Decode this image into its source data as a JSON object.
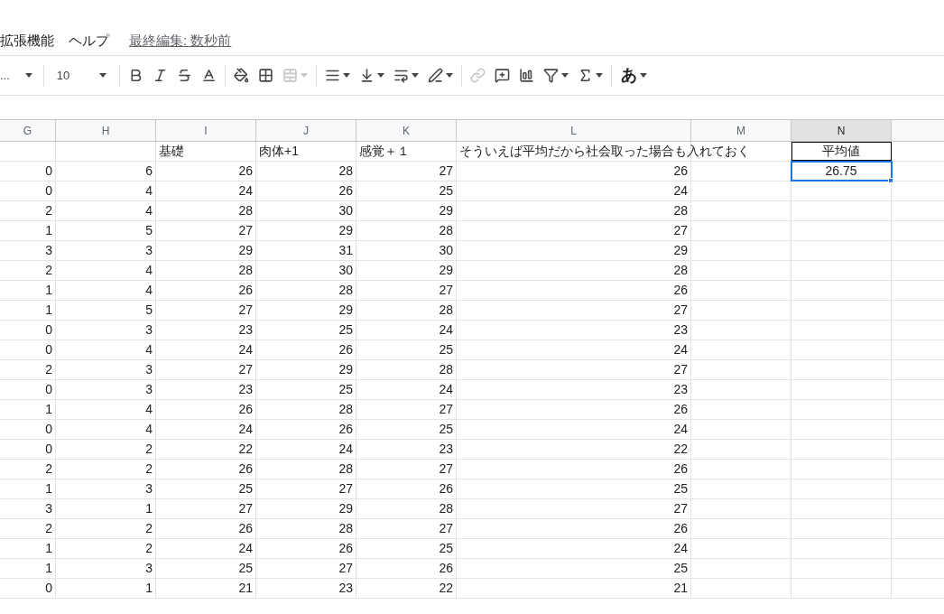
{
  "menu": {
    "items": [
      "拡張機能",
      "ヘルプ"
    ],
    "last_edit": "最終編集: 数秒前"
  },
  "toolbar": {
    "font": "...",
    "font_size": "10",
    "merge_disabled": true,
    "link_disabled": true,
    "input_tool": "あ"
  },
  "columns": [
    {
      "label": "G",
      "selected": false,
      "centered": false
    },
    {
      "label": "H",
      "selected": false,
      "centered": false
    },
    {
      "label": "I",
      "selected": false,
      "centered": false
    },
    {
      "label": "J",
      "selected": false,
      "centered": false
    },
    {
      "label": "K",
      "selected": false,
      "centered": false
    },
    {
      "label": "L",
      "selected": false,
      "centered": false
    },
    {
      "label": "M",
      "selected": false,
      "centered": false
    },
    {
      "label": "N",
      "selected": true,
      "centered": true
    }
  ],
  "rows": [
    {
      "kind": "label",
      "bordered": true,
      "values": {
        "I": "基礎",
        "J": "肉体+1",
        "K": "感覚＋１",
        "L": "そういえば平均だから社会取った場合も入れておく",
        "N": "平均値"
      }
    },
    {
      "kind": "number",
      "values": {
        "G": "0",
        "H": "6",
        "I": "26",
        "J": "28",
        "K": "27",
        "L": "26"
      },
      "active_cell": {
        "text": "26.75"
      }
    },
    {
      "kind": "number",
      "values": {
        "G": "0",
        "H": "4",
        "I": "24",
        "J": "26",
        "K": "25",
        "L": "24"
      }
    },
    {
      "kind": "number",
      "values": {
        "G": "2",
        "H": "4",
        "I": "28",
        "J": "30",
        "K": "29",
        "L": "28"
      }
    },
    {
      "kind": "number",
      "values": {
        "G": "1",
        "H": "5",
        "I": "27",
        "J": "29",
        "K": "28",
        "L": "27"
      }
    },
    {
      "kind": "number",
      "values": {
        "G": "3",
        "H": "3",
        "I": "29",
        "J": "31",
        "K": "30",
        "L": "29"
      }
    },
    {
      "kind": "number",
      "values": {
        "G": "2",
        "H": "4",
        "I": "28",
        "J": "30",
        "K": "29",
        "L": "28"
      }
    },
    {
      "kind": "number",
      "values": {
        "G": "1",
        "H": "4",
        "I": "26",
        "J": "28",
        "K": "27",
        "L": "26"
      }
    },
    {
      "kind": "number",
      "values": {
        "G": "1",
        "H": "5",
        "I": "27",
        "J": "29",
        "K": "28",
        "L": "27"
      }
    },
    {
      "kind": "number",
      "values": {
        "G": "0",
        "H": "3",
        "I": "23",
        "J": "25",
        "K": "24",
        "L": "23"
      }
    },
    {
      "kind": "number",
      "values": {
        "G": "0",
        "H": "4",
        "I": "24",
        "J": "26",
        "K": "25",
        "L": "24"
      }
    },
    {
      "kind": "number",
      "values": {
        "G": "2",
        "H": "3",
        "I": "27",
        "J": "29",
        "K": "28",
        "L": "27"
      }
    },
    {
      "kind": "number",
      "values": {
        "G": "0",
        "H": "3",
        "I": "23",
        "J": "25",
        "K": "24",
        "L": "23"
      }
    },
    {
      "kind": "number",
      "values": {
        "G": "1",
        "H": "4",
        "I": "26",
        "J": "28",
        "K": "27",
        "L": "26"
      }
    },
    {
      "kind": "number",
      "values": {
        "G": "0",
        "H": "4",
        "I": "24",
        "J": "26",
        "K": "25",
        "L": "24"
      }
    },
    {
      "kind": "number",
      "values": {
        "G": "0",
        "H": "2",
        "I": "22",
        "J": "24",
        "K": "23",
        "L": "22"
      }
    },
    {
      "kind": "number",
      "values": {
        "G": "2",
        "H": "2",
        "I": "26",
        "J": "28",
        "K": "27",
        "L": "26"
      }
    },
    {
      "kind": "number",
      "values": {
        "G": "1",
        "H": "3",
        "I": "25",
        "J": "27",
        "K": "26",
        "L": "25"
      }
    },
    {
      "kind": "number",
      "values": {
        "G": "3",
        "H": "1",
        "I": "27",
        "J": "29",
        "K": "28",
        "L": "27"
      }
    },
    {
      "kind": "number",
      "values": {
        "G": "2",
        "H": "2",
        "I": "26",
        "J": "28",
        "K": "27",
        "L": "26"
      }
    },
    {
      "kind": "number",
      "values": {
        "G": "1",
        "H": "2",
        "I": "24",
        "J": "26",
        "K": "25",
        "L": "24"
      }
    },
    {
      "kind": "number",
      "values": {
        "G": "1",
        "H": "3",
        "I": "25",
        "J": "27",
        "K": "26",
        "L": "25"
      }
    },
    {
      "kind": "number",
      "values": {
        "G": "0",
        "H": "1",
        "I": "21",
        "J": "23",
        "K": "22",
        "L": "21"
      }
    }
  ]
}
